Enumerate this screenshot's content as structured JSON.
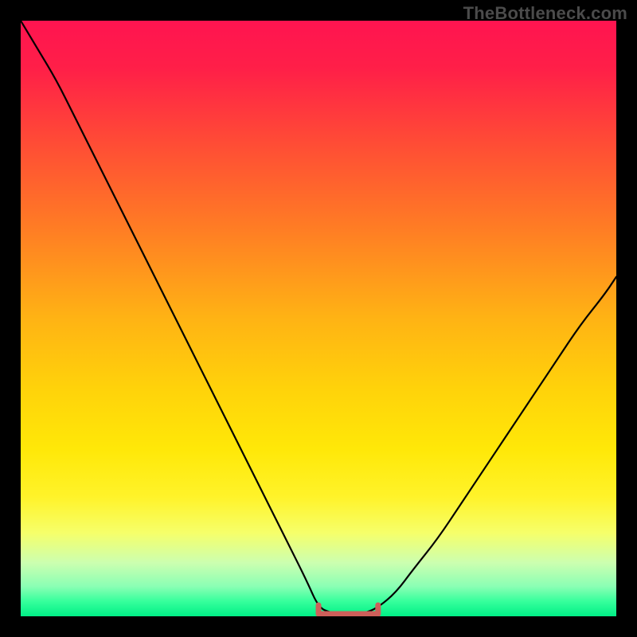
{
  "watermark": "TheBottleneck.com",
  "colors": {
    "frame_background": "#000000",
    "gradient_stops": [
      {
        "offset": 0.0,
        "color": "#ff1450"
      },
      {
        "offset": 0.08,
        "color": "#ff1f48"
      },
      {
        "offset": 0.2,
        "color": "#ff4a36"
      },
      {
        "offset": 0.35,
        "color": "#ff7d24"
      },
      {
        "offset": 0.5,
        "color": "#ffb314"
      },
      {
        "offset": 0.62,
        "color": "#ffd30a"
      },
      {
        "offset": 0.72,
        "color": "#ffe808"
      },
      {
        "offset": 0.8,
        "color": "#fff32a"
      },
      {
        "offset": 0.86,
        "color": "#f6ff6a"
      },
      {
        "offset": 0.91,
        "color": "#ccffb0"
      },
      {
        "offset": 0.95,
        "color": "#8affb4"
      },
      {
        "offset": 0.975,
        "color": "#36ff9c"
      },
      {
        "offset": 1.0,
        "color": "#00ef86"
      }
    ],
    "curve_stroke": "#000000",
    "bottom_marker": "#cd5f5a",
    "watermark_text": "#4b4b4b"
  },
  "chart_data": {
    "type": "line",
    "title": "",
    "xlabel": "",
    "ylabel": "",
    "xlim": [
      0,
      100
    ],
    "ylim": [
      0,
      100
    ],
    "grid": false,
    "legend": false,
    "x": [
      0,
      3,
      6,
      9,
      12,
      15,
      18,
      21,
      24,
      27,
      30,
      33,
      36,
      39,
      42,
      45,
      48,
      50,
      52,
      54,
      56,
      58,
      60,
      63,
      66,
      70,
      74,
      78,
      82,
      86,
      90,
      94,
      98,
      100
    ],
    "values": [
      100,
      95,
      90,
      84,
      78,
      72,
      66,
      60,
      54,
      48,
      42,
      36,
      30,
      24,
      18,
      12,
      6,
      1.5,
      0.6,
      0.4,
      0.4,
      0.6,
      1.5,
      4,
      8,
      13,
      19,
      25,
      31,
      37,
      43,
      49,
      54,
      57
    ],
    "annotations": [
      {
        "kind": "flat_segment_marker",
        "x_start": 50,
        "x_end": 60,
        "y": 0.4
      }
    ],
    "notes": "V-shaped bottleneck curve on rainbow gradient; minimum plateau near x≈50–60 marked by a short salmon-colored bracket at the bottom."
  }
}
